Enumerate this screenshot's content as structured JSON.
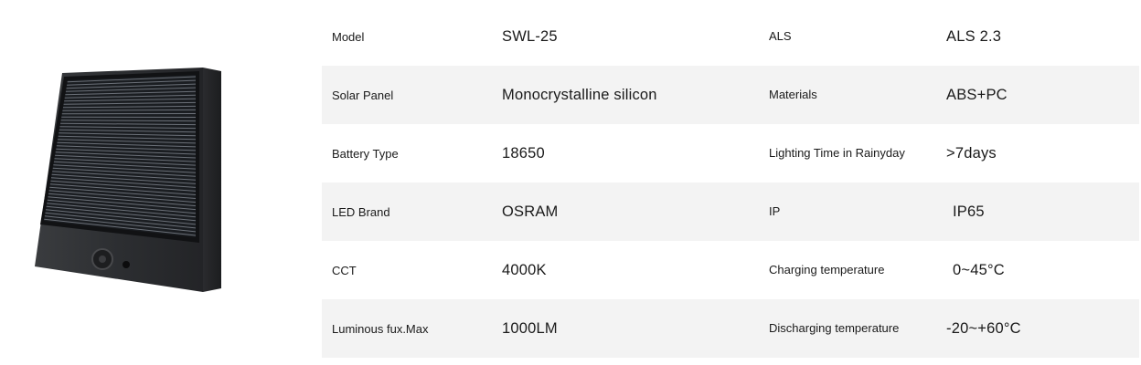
{
  "product": {
    "image_alt": "solar wall light"
  },
  "specs": [
    {
      "label": "Model",
      "value": "SWL-25",
      "label2": "ALS",
      "value2": "ALS 2.3",
      "shaded": false,
      "indent2": false
    },
    {
      "label": "Solar Panel",
      "value": "Monocrystalline silicon",
      "label2": "Materials",
      "value2": "ABS+PC",
      "shaded": true,
      "indent2": false
    },
    {
      "label": "Battery Type",
      "value": "18650",
      "label2": "Lighting Time in Rainyday",
      "value2": ">7days",
      "shaded": false,
      "indent2": false
    },
    {
      "label": "LED Brand",
      "value": "OSRAM",
      "label2": "IP",
      "value2": "IP65",
      "shaded": true,
      "indent2": true
    },
    {
      "label": "CCT",
      "value": "4000K",
      "label2": "Charging temperature",
      "value2": "0~45°C",
      "shaded": false,
      "indent2": true
    },
    {
      "label": "Luminous fux.Max",
      "value": "1000LM",
      "label2": "Discharging temperature",
      "value2": "-20~+60°C",
      "shaded": true,
      "indent2": false
    }
  ]
}
